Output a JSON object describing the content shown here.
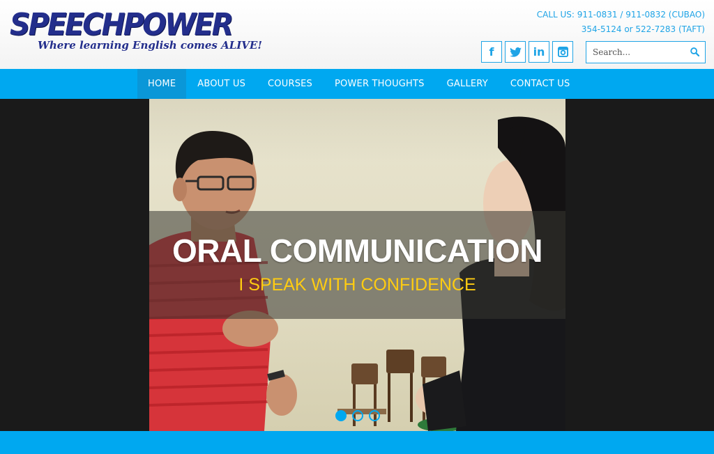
{
  "logo": {
    "name": "SPEECHPOWER",
    "tagline": "Where learning English comes ALIVE!"
  },
  "contact": {
    "line1": "CALL US: 911-0831 / 911-0832 (CUBAO)",
    "line2": "354-5124 or 522-7283 (TAFT)"
  },
  "social": [
    {
      "name": "facebook-icon",
      "glyph": "f"
    },
    {
      "name": "twitter-icon",
      "glyph": ""
    },
    {
      "name": "linkedin-icon",
      "glyph": "in"
    },
    {
      "name": "instagram-icon",
      "glyph": ""
    }
  ],
  "search": {
    "placeholder": "Search..."
  },
  "nav": {
    "items": [
      {
        "label": "HOME",
        "active": true
      },
      {
        "label": "ABOUT US"
      },
      {
        "label": "COURSES"
      },
      {
        "label": "POWER THOUGHTS"
      },
      {
        "label": "GALLERY"
      },
      {
        "label": "CONTACT US"
      }
    ]
  },
  "slider": {
    "title": "ORAL COMMUNICATION",
    "subtitle": "I SPEAK WITH CONFIDENCE",
    "slide_count": 3,
    "active_slide": 1
  },
  "colors": {
    "accent": "#00a8f0",
    "brand": "#232e8c",
    "highlight": "#ffcc11"
  }
}
